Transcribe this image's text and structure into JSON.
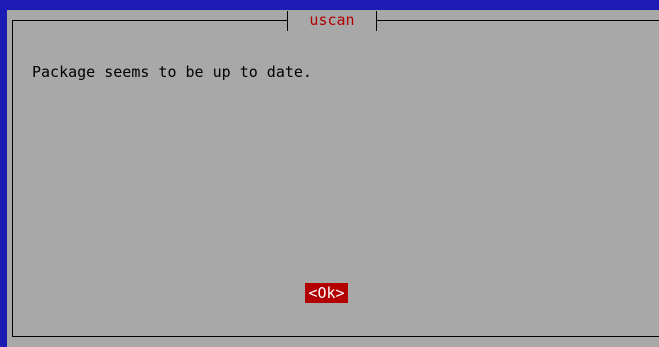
{
  "dialog": {
    "title": "uscan",
    "message": "Package seems to be up to date."
  },
  "buttons": {
    "ok_label": "<Ok>"
  },
  "colors": {
    "background": "#1c1cb4",
    "dialog": "#a8a8a8",
    "title_text": "#b20000",
    "button_selected_bg": "#b20000",
    "button_selected_text": "#ffffff"
  }
}
